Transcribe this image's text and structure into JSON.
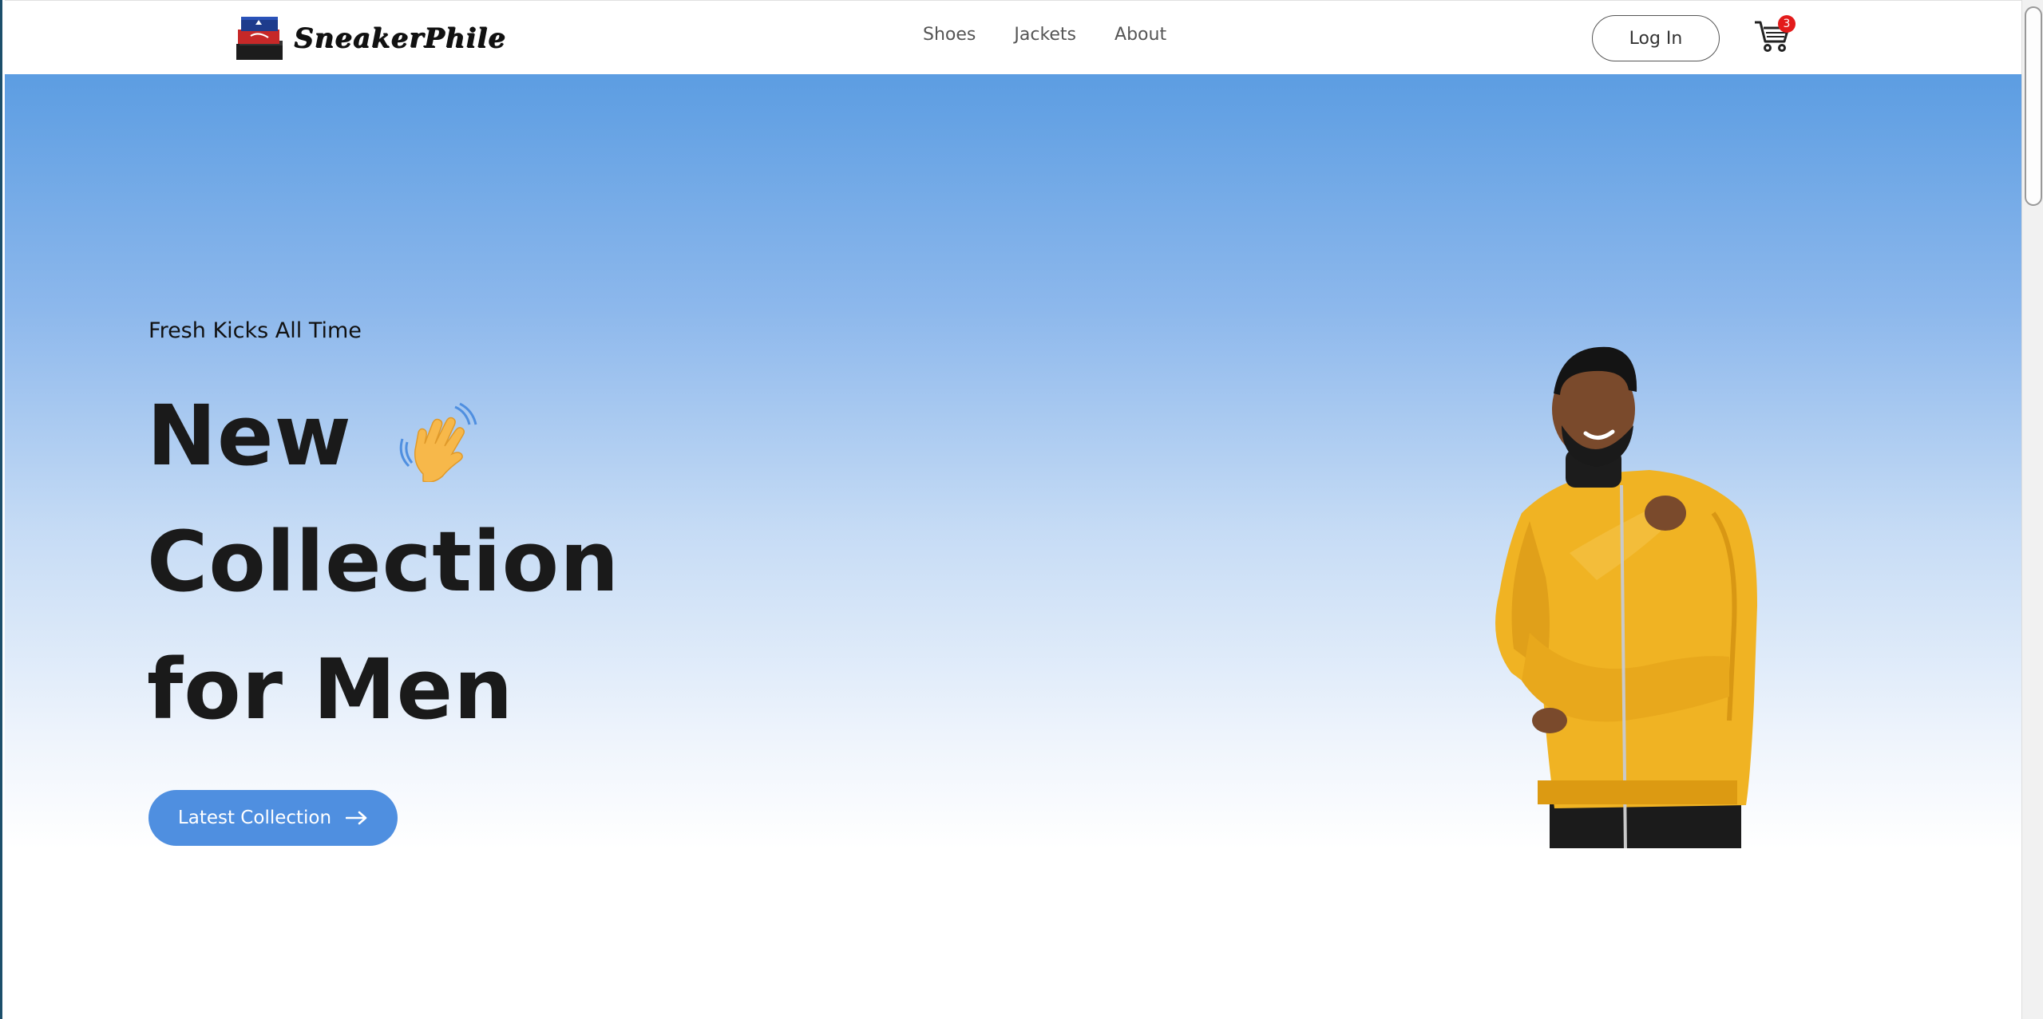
{
  "brand": {
    "name": "SneakerPhile",
    "logo_icon": "shoebox-stack-icon"
  },
  "nav": {
    "links": [
      "Shoes",
      "Jackets",
      "About"
    ],
    "login_label": "Log In",
    "cart_icon": "shopping-cart-icon",
    "cart_count": "3"
  },
  "hero": {
    "tagline": "Fresh Kicks All Time",
    "headline": [
      "New",
      "Collection",
      "for Men"
    ],
    "headline_emoji": "waving-hand-icon",
    "cta_label": "Latest Collection",
    "cta_icon": "arrow-right-icon",
    "image": "man-in-yellow-jacket"
  },
  "colors": {
    "accent": "#4f8fe0",
    "hero_top": "#5c9de2",
    "badge": "#e31b1b",
    "jacket": "#f0b323"
  }
}
